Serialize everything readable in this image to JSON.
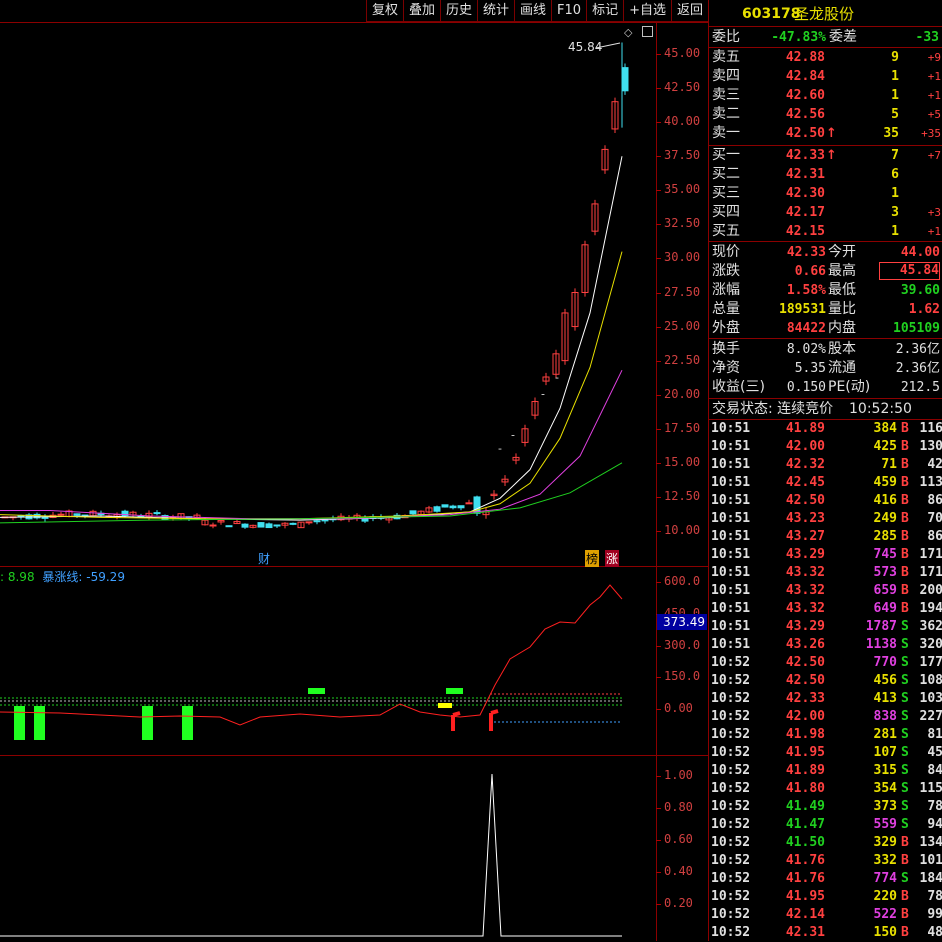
{
  "toolbar": {
    "buttons": [
      "复权",
      "叠加",
      "历史",
      "统计",
      "画线",
      "F10",
      "标记",
      "+自选",
      "返回"
    ]
  },
  "stock": {
    "code": "603178",
    "name": "圣龙股份"
  },
  "price_axis": {
    "labels": [
      "45.00",
      "42.50",
      "40.00",
      "37.50",
      "35.00",
      "32.50",
      "30.00",
      "27.50",
      "25.00",
      "22.50",
      "20.00",
      "17.50",
      "15.00",
      "12.50",
      "10.00"
    ]
  },
  "high_marker": "45.84",
  "events": {
    "cai": "财",
    "bang": "榜",
    "zhang": "涨"
  },
  "indicator": {
    "value1": ": 8.98",
    "line_name": "暴涨线: -59.29",
    "current": "373.49",
    "axis": [
      "600.0",
      "450.0",
      "300.0",
      "150.0",
      "0.00"
    ]
  },
  "lower_axis": [
    "1.00",
    "0.80",
    "0.60",
    "0.40",
    "0.20"
  ],
  "order_book": {
    "weibi_label": "委比",
    "weibi": "-47.83%",
    "weicha_label": "委差",
    "weicha": "-33",
    "asks": [
      {
        "label": "卖五",
        "price": "42.88",
        "vol": "9",
        "chg": "+9",
        "arrow": ""
      },
      {
        "label": "卖四",
        "price": "42.84",
        "vol": "1",
        "chg": "+1",
        "arrow": ""
      },
      {
        "label": "卖三",
        "price": "42.60",
        "vol": "1",
        "chg": "+1",
        "arrow": ""
      },
      {
        "label": "卖二",
        "price": "42.56",
        "vol": "5",
        "chg": "+5",
        "arrow": ""
      },
      {
        "label": "卖一",
        "price": "42.50",
        "vol": "35",
        "chg": "+35",
        "arrow": "↑"
      }
    ],
    "bids": [
      {
        "label": "买一",
        "price": "42.33",
        "vol": "7",
        "chg": "+7",
        "arrow": "↑"
      },
      {
        "label": "买二",
        "price": "42.31",
        "vol": "6",
        "chg": "",
        "arrow": ""
      },
      {
        "label": "买三",
        "price": "42.30",
        "vol": "1",
        "chg": "",
        "arrow": ""
      },
      {
        "label": "买四",
        "price": "42.17",
        "vol": "3",
        "chg": "+3",
        "arrow": ""
      },
      {
        "label": "买五",
        "price": "42.15",
        "vol": "1",
        "chg": "+1",
        "arrow": ""
      }
    ]
  },
  "stats": [
    {
      "l1": "现价",
      "v1": "42.33",
      "c1": "red",
      "l2": "今开",
      "v2": "44.00",
      "c2": "red",
      "box": false
    },
    {
      "l1": "涨跌",
      "v1": "0.66",
      "c1": "red",
      "l2": "最高",
      "v2": "45.84",
      "c2": "red",
      "box": true
    },
    {
      "l1": "涨幅",
      "v1": "1.58%",
      "c1": "red",
      "l2": "最低",
      "v2": "39.60",
      "c2": "green",
      "box": false
    },
    {
      "l1": "总量",
      "v1": "189531",
      "c1": "yellow",
      "l2": "量比",
      "v2": "1.62",
      "c2": "red",
      "box": false
    },
    {
      "l1": "外盘",
      "v1": "84422",
      "c1": "red",
      "l2": "内盘",
      "v2": "105109",
      "c2": "green",
      "box": false
    }
  ],
  "stats2": [
    {
      "l1": "换手",
      "v1": "8.02%",
      "l2": "股本",
      "v2": "2.36亿"
    },
    {
      "l1": "净资",
      "v1": "5.35",
      "l2": "流通",
      "v2": "2.36亿"
    },
    {
      "l1": "收益(三)",
      "v1": "0.150",
      "l2": "PE(动)",
      "v2": "212.5"
    }
  ],
  "trade_status": {
    "label": "交易状态: 连续竞价",
    "time": "10:52:50"
  },
  "ticks": [
    {
      "t": "10:51",
      "p": "41.89",
      "pc": "red",
      "v": "384",
      "vc": "yellow",
      "s": "B",
      "n": "116"
    },
    {
      "t": "10:51",
      "p": "42.00",
      "pc": "red",
      "v": "425",
      "vc": "yellow",
      "s": "B",
      "n": "130"
    },
    {
      "t": "10:51",
      "p": "42.32",
      "pc": "red",
      "v": "71",
      "vc": "yellow",
      "s": "B",
      "n": "42"
    },
    {
      "t": "10:51",
      "p": "42.45",
      "pc": "red",
      "v": "459",
      "vc": "yellow",
      "s": "B",
      "n": "113"
    },
    {
      "t": "10:51",
      "p": "42.50",
      "pc": "red",
      "v": "416",
      "vc": "yellow",
      "s": "B",
      "n": "86"
    },
    {
      "t": "10:51",
      "p": "43.23",
      "pc": "red",
      "v": "249",
      "vc": "yellow",
      "s": "B",
      "n": "70"
    },
    {
      "t": "10:51",
      "p": "43.27",
      "pc": "red",
      "v": "285",
      "vc": "yellow",
      "s": "B",
      "n": "86"
    },
    {
      "t": "10:51",
      "p": "43.29",
      "pc": "red",
      "v": "745",
      "vc": "mag",
      "s": "B",
      "n": "171"
    },
    {
      "t": "10:51",
      "p": "43.32",
      "pc": "red",
      "v": "573",
      "vc": "mag",
      "s": "B",
      "n": "171"
    },
    {
      "t": "10:51",
      "p": "43.32",
      "pc": "red",
      "v": "659",
      "vc": "mag",
      "s": "B",
      "n": "200"
    },
    {
      "t": "10:51",
      "p": "43.32",
      "pc": "red",
      "v": "649",
      "vc": "mag",
      "s": "B",
      "n": "194"
    },
    {
      "t": "10:51",
      "p": "43.29",
      "pc": "red",
      "v": "1787",
      "vc": "mag",
      "s": "S",
      "n": "362"
    },
    {
      "t": "10:51",
      "p": "43.26",
      "pc": "red",
      "v": "1138",
      "vc": "mag",
      "s": "S",
      "n": "320"
    },
    {
      "t": "10:52",
      "p": "42.50",
      "pc": "red",
      "v": "770",
      "vc": "mag",
      "s": "S",
      "n": "177"
    },
    {
      "t": "10:52",
      "p": "42.50",
      "pc": "red",
      "v": "456",
      "vc": "yellow",
      "s": "S",
      "n": "108"
    },
    {
      "t": "10:52",
      "p": "42.33",
      "pc": "red",
      "v": "413",
      "vc": "yellow",
      "s": "S",
      "n": "103"
    },
    {
      "t": "10:52",
      "p": "42.00",
      "pc": "red",
      "v": "838",
      "vc": "mag",
      "s": "S",
      "n": "227"
    },
    {
      "t": "10:52",
      "p": "41.98",
      "pc": "red",
      "v": "281",
      "vc": "yellow",
      "s": "S",
      "n": "81"
    },
    {
      "t": "10:52",
      "p": "41.95",
      "pc": "red",
      "v": "107",
      "vc": "yellow",
      "s": "S",
      "n": "45"
    },
    {
      "t": "10:52",
      "p": "41.89",
      "pc": "red",
      "v": "315",
      "vc": "yellow",
      "s": "S",
      "n": "84"
    },
    {
      "t": "10:52",
      "p": "41.80",
      "pc": "red",
      "v": "354",
      "vc": "yellow",
      "s": "S",
      "n": "115"
    },
    {
      "t": "10:52",
      "p": "41.49",
      "pc": "green",
      "v": "373",
      "vc": "yellow",
      "s": "S",
      "n": "78"
    },
    {
      "t": "10:52",
      "p": "41.47",
      "pc": "green",
      "v": "559",
      "vc": "mag",
      "s": "S",
      "n": "94"
    },
    {
      "t": "10:52",
      "p": "41.50",
      "pc": "green",
      "v": "329",
      "vc": "yellow",
      "s": "B",
      "n": "134"
    },
    {
      "t": "10:52",
      "p": "41.76",
      "pc": "red",
      "v": "332",
      "vc": "yellow",
      "s": "B",
      "n": "101"
    },
    {
      "t": "10:52",
      "p": "41.76",
      "pc": "red",
      "v": "774",
      "vc": "mag",
      "s": "S",
      "n": "184"
    },
    {
      "t": "10:52",
      "p": "41.95",
      "pc": "red",
      "v": "220",
      "vc": "yellow",
      "s": "B",
      "n": "78"
    },
    {
      "t": "10:52",
      "p": "42.14",
      "pc": "red",
      "v": "522",
      "vc": "mag",
      "s": "B",
      "n": "99"
    },
    {
      "t": "10:52",
      "p": "42.31",
      "pc": "red",
      "v": "150",
      "vc": "yellow",
      "s": "B",
      "n": "48"
    }
  ],
  "colors": {
    "up": "#ff4040",
    "down": "#20d020",
    "panel_border": "#8b0000",
    "cyan": "#40e0f0"
  }
}
